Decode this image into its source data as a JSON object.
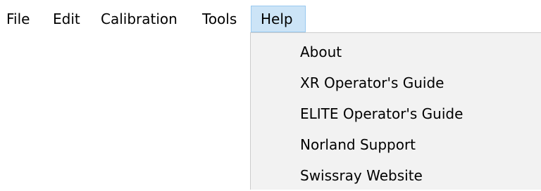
{
  "menubar": {
    "items": [
      {
        "label": "File"
      },
      {
        "label": "Edit"
      },
      {
        "label": "Calibration"
      },
      {
        "label": "Tools"
      },
      {
        "label": "Help"
      }
    ]
  },
  "help_menu": {
    "items": [
      {
        "label": "About"
      },
      {
        "label": "XR Operator's Guide"
      },
      {
        "label": "ELITE Operator's Guide"
      },
      {
        "label": "Norland Support"
      },
      {
        "label": "Swissray Website"
      }
    ]
  }
}
